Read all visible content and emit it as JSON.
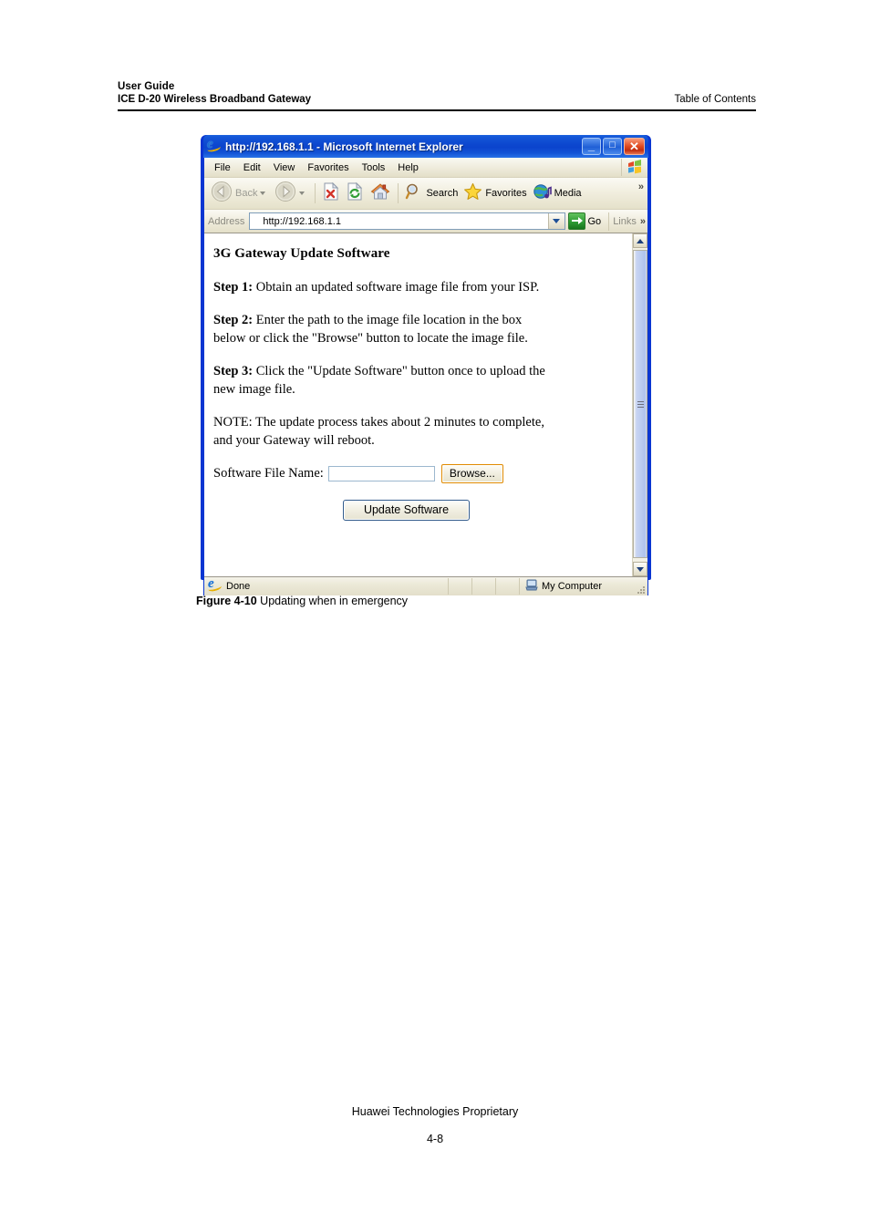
{
  "document": {
    "header": {
      "line1": "User Guide",
      "line2_left": "ICE D-20 Wireless Broadband Gateway",
      "line2_right": "Table of Contents"
    },
    "figure_caption_label": "Figure 4-10",
    "figure_caption_text": " Updating when in emergency",
    "footer": "Huawei Technologies Proprietary",
    "page_number": "4-8"
  },
  "browser": {
    "title": "http://192.168.1.1 - Microsoft Internet Explorer",
    "title_icon": "ie-e-icon",
    "window_buttons": {
      "minimize": "_",
      "maximize": "□",
      "close": "✕"
    },
    "menu": [
      {
        "label": "File"
      },
      {
        "label": "Edit"
      },
      {
        "label": "View"
      },
      {
        "label": "Favorites"
      },
      {
        "label": "Tools"
      },
      {
        "label": "Help"
      }
    ],
    "toolbar": {
      "back_label": "Back",
      "forward_label": "",
      "stop_icon": "stop-page-icon",
      "refresh_icon": "refresh-icon",
      "home_icon": "home-icon",
      "search_label": "Search",
      "favorites_label": "Favorites",
      "media_label": "Media",
      "overflow_chevron": "»"
    },
    "address_bar": {
      "label": "Address",
      "value": "http://192.168.1.1",
      "placeholder": "",
      "go_label": "Go",
      "links_label": "Links",
      "overflow_chevron": "»"
    },
    "status_bar": {
      "status_text": "Done",
      "zone_text": "My Computer"
    }
  },
  "page": {
    "heading": "3G Gateway Update Software",
    "steps": [
      {
        "label": "Step 1:",
        "text": " Obtain an updated software image file from your ISP."
      },
      {
        "label": "Step 2:",
        "text": " Enter the path to the image file location in the box below or click the \"Browse\" button to locate the image file."
      },
      {
        "label": "Step 3:",
        "text": " Click the \"Update Software\" button once to upload the new image file."
      }
    ],
    "note_label": "NOTE:",
    "note_text": " The update process takes about 2 minutes to complete, and your Gateway will reboot.",
    "form": {
      "file_label": "Software File Name:",
      "file_value": "",
      "file_placeholder": "",
      "browse_label": "Browse...",
      "submit_label": "Update Software"
    }
  },
  "colors": {
    "title_bar_blue": "#0a36d2",
    "chrome_beige": "#ece9d8",
    "browse_border_orange": "#e08a00",
    "go_green": "#2e9c34",
    "scrollbar_thumb_blue": "#bccdf0"
  }
}
